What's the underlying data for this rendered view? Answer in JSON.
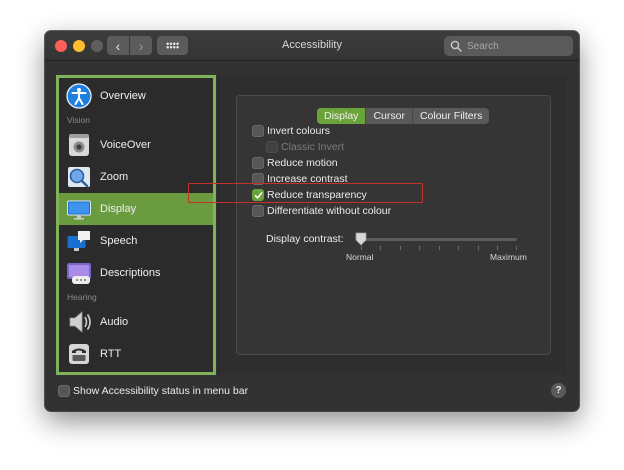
{
  "window": {
    "title": "Accessibility",
    "search": {
      "placeholder": "Search",
      "value": ""
    }
  },
  "sidebar": {
    "items": [
      {
        "label": "Overview",
        "icon": "overview-icon"
      },
      {
        "label": "VoiceOver",
        "icon": "voiceover-icon"
      },
      {
        "label": "Zoom",
        "icon": "zoom-icon"
      },
      {
        "label": "Display",
        "icon": "display-icon",
        "selected": true
      },
      {
        "label": "Speech",
        "icon": "speech-icon"
      },
      {
        "label": "Descriptions",
        "icon": "descriptions-icon"
      },
      {
        "label": "Audio",
        "icon": "audio-icon"
      },
      {
        "label": "RTT",
        "icon": "rtt-icon"
      }
    ],
    "sections": {
      "vision": "Vision",
      "hearing": "Hearing"
    }
  },
  "tabs": [
    {
      "label": "Display",
      "active": true
    },
    {
      "label": "Cursor",
      "active": false
    },
    {
      "label": "Colour Filters",
      "active": false
    }
  ],
  "options": [
    {
      "label": "Invert colours",
      "checked": false,
      "disabled": false
    },
    {
      "label": "Classic Invert",
      "checked": false,
      "disabled": true
    },
    {
      "label": "Reduce motion",
      "checked": false,
      "disabled": false
    },
    {
      "label": "Increase contrast",
      "checked": false,
      "disabled": false
    },
    {
      "label": "Reduce transparency",
      "checked": true,
      "disabled": false
    },
    {
      "label": "Differentiate without colour",
      "checked": false,
      "disabled": false
    }
  ],
  "contrast": {
    "label": "Display contrast:",
    "min_label": "Normal",
    "max_label": "Maximum",
    "value": 0
  },
  "footer": {
    "menu_bar_status": {
      "label": "Show Accessibility status in menu bar",
      "checked": false
    },
    "help_label": "?"
  },
  "colors": {
    "accent": "#6aa338",
    "sidebar_selection": "#6b9b3f",
    "sidebar_outline": "#7fb25a",
    "highlight_box": "#c6302b"
  }
}
